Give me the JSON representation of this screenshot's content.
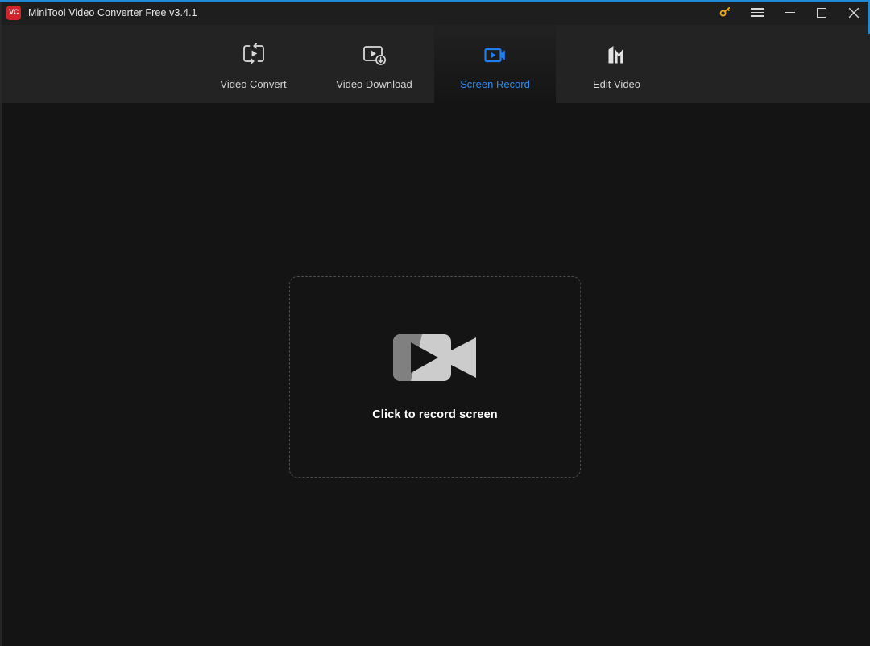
{
  "window": {
    "title": "MiniTool Video Converter Free v3.4.1",
    "logo_text": "VC",
    "logo_color": "#d0252a",
    "accent_color": "#1f8ad6",
    "background_color": "#141414",
    "titlebar_color": "#1e1e1e"
  },
  "titlebar_controls": [
    {
      "name": "key-icon",
      "label": "Register",
      "color": "#f0a81e"
    },
    {
      "name": "menu-icon",
      "label": "Menu",
      "color": "#d8d8d8"
    },
    {
      "name": "minimize-icon",
      "label": "Minimize",
      "color": "#d8d8d8"
    },
    {
      "name": "maximize-icon",
      "label": "Maximize",
      "color": "#d8d8d8"
    },
    {
      "name": "close-icon",
      "label": "Close",
      "color": "#d8d8d8"
    }
  ],
  "tabs": [
    {
      "label": "Video Convert",
      "icon": "video-convert-icon",
      "active": false
    },
    {
      "label": "Video Download",
      "icon": "video-download-icon",
      "active": false
    },
    {
      "label": "Screen Record",
      "icon": "screen-record-icon",
      "active": true
    },
    {
      "label": "Edit Video",
      "icon": "edit-video-icon",
      "active": false
    }
  ],
  "tab_colors": {
    "inactive_text": "#d4d4d4",
    "active_text": "#2e8bef",
    "strip_background": "#232323",
    "active_background": "#1a1a1a"
  },
  "main": {
    "dropzone": {
      "label": "Click to record screen",
      "icon": "camcorder-icon",
      "border_style": "dashed",
      "border_color": "#4a4a4a",
      "icon_color_light": "#cccccc",
      "icon_color_shade": "#808080"
    }
  }
}
